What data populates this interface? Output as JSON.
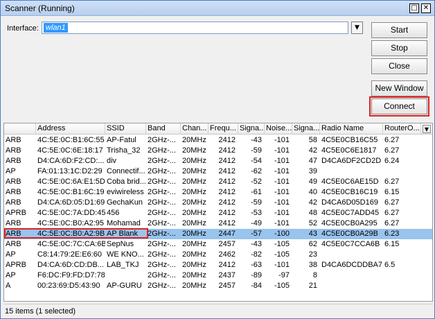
{
  "window": {
    "title": "Scanner (Running)",
    "maximize_glyph": "□",
    "close_glyph": "✕"
  },
  "interface": {
    "label": "Interface:",
    "value": "wlan1",
    "dropdown_glyph": "▼"
  },
  "buttons": {
    "start": "Start",
    "stop": "Stop",
    "close": "Close",
    "new_window": "New Window",
    "connect": "Connect"
  },
  "table": {
    "headers": [
      "",
      "Address",
      "SSID",
      "Band",
      "Chan...",
      "Frequ...",
      "Signa...",
      "Noise...",
      "Signa...",
      "Radio Name",
      "RouterO..."
    ],
    "header_dropdown": "▼",
    "rows": [
      [
        "ARB",
        "4C:5E:0C:B1:6C:55",
        "AP-Fatul",
        "2GHz-...",
        "20MHz",
        "2412",
        "-43",
        "-101",
        "58",
        "4C5E0CB16C55",
        "6.27"
      ],
      [
        "ARB",
        "4C:5E:0C:6E:18:17",
        "Trisha_32",
        "2GHz-...",
        "20MHz",
        "2412",
        "-59",
        "-101",
        "42",
        "4C5E0C6E1817",
        "6.27"
      ],
      [
        "ARB",
        "D4:CA:6D:F2:CD:...",
        "div",
        "2GHz-...",
        "20MHz",
        "2412",
        "-54",
        "-101",
        "47",
        "D4CA6DF2CD2D",
        "6.24"
      ],
      [
        "AP",
        "FA:01:13:1C:D2:29",
        "Connectif...",
        "2GHz-...",
        "20MHz",
        "2412",
        "-62",
        "-101",
        "39",
        "",
        ""
      ],
      [
        "ARB",
        "4C:5E:0C:6A:E1:5D",
        "Coba brid...",
        "2GHz-...",
        "20MHz",
        "2412",
        "-52",
        "-101",
        "49",
        "4C5E0C6AE15D",
        "6.27"
      ],
      [
        "ARB",
        "4C:5E:0C:B1:6C:19",
        "eviwireless",
        "2GHz-...",
        "20MHz",
        "2412",
        "-61",
        "-101",
        "40",
        "4C5E0CB16C19",
        "6.15"
      ],
      [
        "ARB",
        "D4:CA:6D:05:D1:69",
        "GechaKun",
        "2GHz-...",
        "20MHz",
        "2412",
        "-59",
        "-101",
        "42",
        "D4CA6D05D169",
        "6.27"
      ],
      [
        "APRB",
        "4C:5E:0C:7A:DD:45",
        "456",
        "2GHz-...",
        "20MHz",
        "2412",
        "-53",
        "-101",
        "48",
        "4C5E0C7ADD45",
        "6.27"
      ],
      [
        "ARB",
        "4C:5E:0C:B0:A2:95",
        "Mohamad",
        "2GHz-...",
        "20MHz",
        "2412",
        "-49",
        "-101",
        "52",
        "4C5E0CB0A295",
        "6.27"
      ],
      [
        "ARB",
        "4C:5E:0C:B0:A2:9B",
        "AP Blank",
        "2GHz-...",
        "20MHz",
        "2447",
        "-57",
        "-100",
        "43",
        "4C5E0CB0A29B",
        "6.23"
      ],
      [
        "ARB",
        "4C:5E:0C:7C:CA:6B",
        "SepNus",
        "2GHz-...",
        "20MHz",
        "2457",
        "-43",
        "-105",
        "62",
        "4C5E0C7CCA6B",
        "6.15"
      ],
      [
        "AP",
        "C8:14:79:2E:E6:60",
        "WE KNO...",
        "2GHz-...",
        "20MHz",
        "2462",
        "-82",
        "-105",
        "23",
        "",
        ""
      ],
      [
        "APRB",
        "D4:CA:6D:CD:DB...",
        "LAB_TKJ",
        "2GHz-...",
        "20MHz",
        "2412",
        "-63",
        "-101",
        "38",
        "D4CA6DCDDBA7",
        "6.5"
      ],
      [
        "AP",
        "F6:DC:F9:FD:D7:78",
        "",
        "2GHz-...",
        "20MHz",
        "2437",
        "-89",
        "-97",
        "8",
        "",
        ""
      ],
      [
        "A",
        "00:23:69:D5:43:90",
        "AP-GURU",
        "2GHz-...",
        "20MHz",
        "2457",
        "-84",
        "-105",
        "21",
        "",
        ""
      ]
    ],
    "selected_row": 9
  },
  "status": {
    "text": "15 items (1 selected)"
  },
  "colors": {
    "selection": "#99c4ee",
    "highlight_outline": "#e02020",
    "input_selection": "#3399ff"
  }
}
